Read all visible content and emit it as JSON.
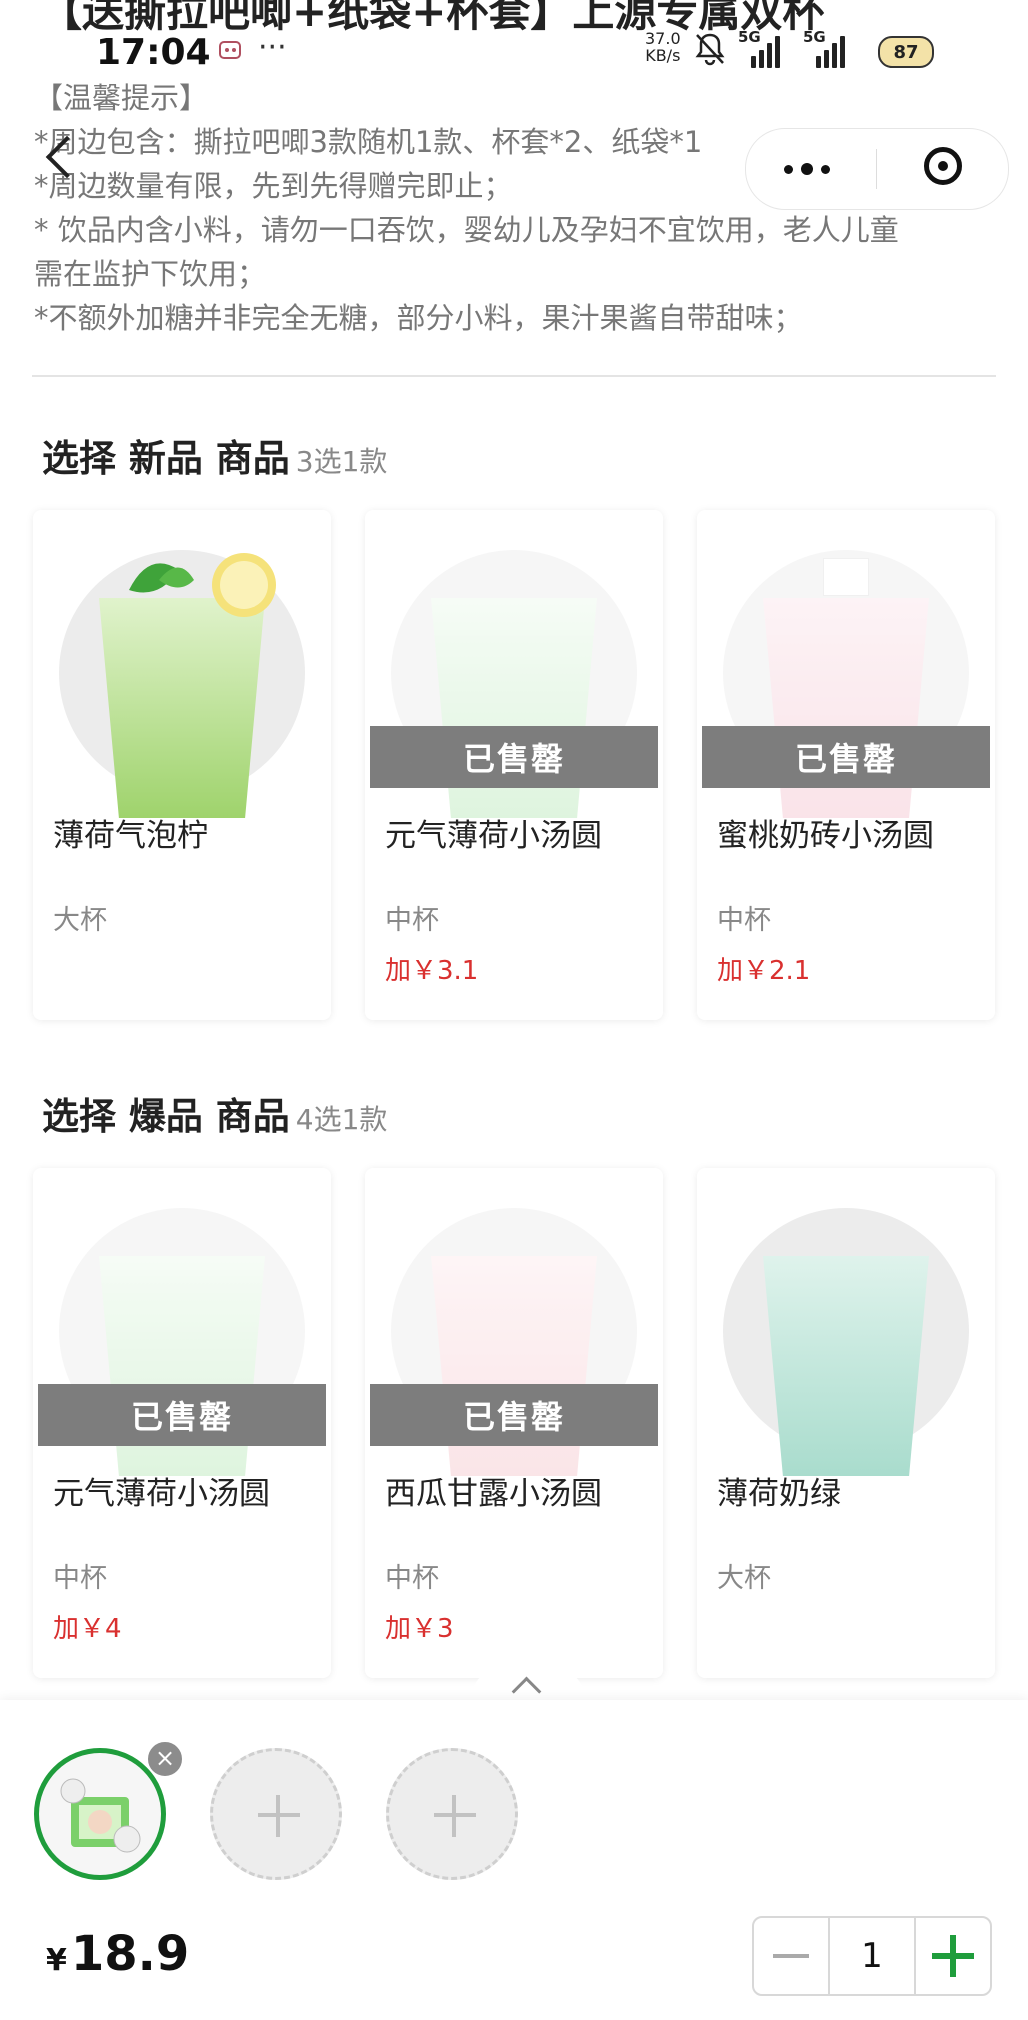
{
  "page_title_cut": "【送撕拉吧唧+纸袋+杯套】上源专属双杯",
  "status_bar": {
    "time": "17:04",
    "net_speed_value": "37.0",
    "net_speed_unit": "KB/s",
    "sig1": "5G",
    "sig2": "5G",
    "battery": "87",
    "more": "···",
    "app_icon": "notification-icon"
  },
  "notice": {
    "title": "【温馨提示】",
    "lines": [
      "*周边包含：撕拉吧唧3款随机1款、杯套*2、纸袋*1",
      "*周边数量有限，先到先得赠完即止；",
      "* 饮品内含小料，请勿一口吞饮，婴幼儿及孕妇不宜饮用，老人儿童",
      "需在监护下饮用；",
      "*不额外加糖并非完全无糖，部分小料，果汁果酱自带甜味；"
    ]
  },
  "section_new": {
    "title": "选择 新品 商品",
    "sub": "3选1款",
    "products": [
      {
        "name": "薄荷气泡柠",
        "size": "大杯",
        "extra": "",
        "sold_out": false,
        "color": "#9fd36c"
      },
      {
        "name": "元气薄荷小汤圆",
        "size": "中杯",
        "extra": "加￥3.1",
        "sold_out": true,
        "sold_label": "已售罄",
        "color": "#b8e8b8"
      },
      {
        "name": "蜜桃奶砖小汤圆",
        "size": "中杯",
        "extra": "加￥2.1",
        "sold_out": true,
        "sold_label": "已售罄",
        "color": "#f4c3cf"
      }
    ]
  },
  "section_hot": {
    "title": "选择 爆品 商品",
    "sub": "4选1款",
    "products": [
      {
        "name": "元气薄荷小汤圆",
        "size": "中杯",
        "extra": "加￥4",
        "sold_out": true,
        "sold_label": "已售罄",
        "color": "#b8e8b8"
      },
      {
        "name": "西瓜甘露小汤圆",
        "size": "中杯",
        "extra": "加￥3",
        "sold_out": true,
        "sold_label": "已售罄",
        "color": "#f6c6cc"
      },
      {
        "name": "薄荷奶绿",
        "size": "大杯",
        "extra": "",
        "sold_out": false,
        "color": "#a9dccd"
      }
    ]
  },
  "cart": {
    "remove": "×",
    "currency": "¥",
    "price": "18.9",
    "quantity": "1"
  },
  "colors": {
    "accent": "#1f9d3c",
    "price_red": "#d9302f",
    "sold_out_bg": "#7d7d7d"
  }
}
